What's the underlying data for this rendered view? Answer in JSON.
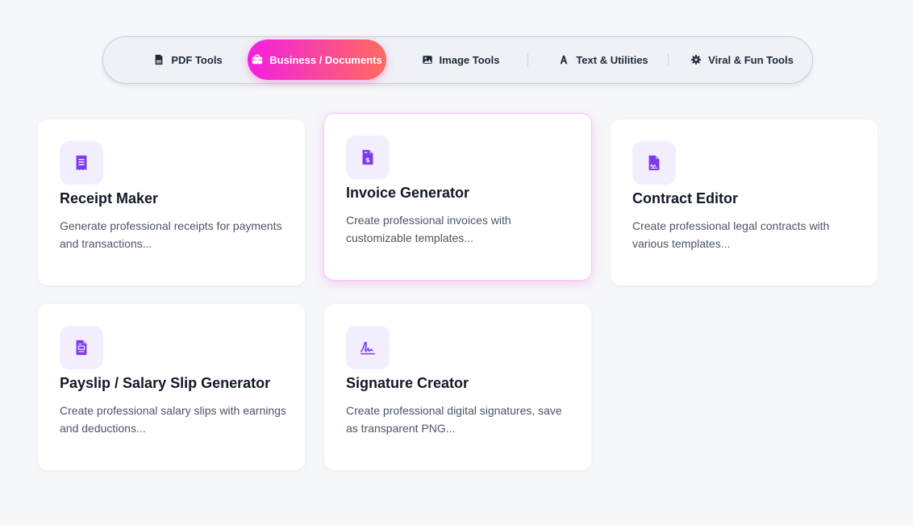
{
  "tabs": [
    {
      "label": "PDF Tools",
      "icon": "pdf-file-icon"
    },
    {
      "label": "Business / Documents",
      "icon": "briefcase-icon"
    },
    {
      "label": "Image Tools",
      "icon": "image-icon"
    },
    {
      "label": "Text & Utilities",
      "icon": "text-font-icon"
    },
    {
      "label": "Viral & Fun Tools",
      "icon": "gear-icon"
    }
  ],
  "active_tab": "Business / Documents",
  "accent_gradient": [
    "#f21fe0",
    "#ff6b5e"
  ],
  "icon_color": "#7c3aed",
  "cards": [
    {
      "title": "Receipt Maker",
      "description": "Generate professional receipts for payments and transactions...",
      "icon": "receipt-icon"
    },
    {
      "title": "Invoice Generator",
      "description": "Create professional invoices with customizable templates...",
      "icon": "invoice-dollar-icon"
    },
    {
      "title": "Contract Editor",
      "description": "Create professional legal contracts with various templates...",
      "icon": "contract-signature-icon"
    },
    {
      "title": "Payslip / Salary Slip Generator",
      "description": "Create professional salary slips with earnings and deductions...",
      "icon": "payslip-icon"
    },
    {
      "title": "Signature Creator",
      "description": "Create professional digital signatures, save as transparent PNG...",
      "icon": "signature-icon"
    }
  ]
}
